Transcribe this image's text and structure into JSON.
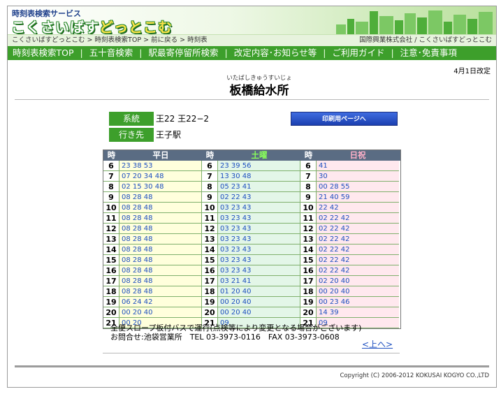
{
  "header": {
    "service_label": "時刻表検索サービス",
    "logo_part1": "こくさいばす",
    "logo_part2": "どっとこむ"
  },
  "breadcrumb": {
    "items": [
      "こくさいばすどっとこむ",
      "時刻表検索TOP",
      "前に戻る",
      "時刻表"
    ],
    "sep": ">",
    "company": "国際興業株式会社",
    "company_sep": "/",
    "site": "こくさいばすどっとこむ"
  },
  "menu": {
    "items": [
      "時刻表検索TOP",
      "五十音検索",
      "駅最寄停留所検索",
      "改定内容･お知らせ等",
      "ご利用ガイド",
      "注意･免責事項"
    ],
    "sep": "|"
  },
  "page": {
    "revised": "4月1日改定",
    "stop_ruby": "いたばしきゅうすいじょ",
    "stop_name": "板橋給水所"
  },
  "route": {
    "route_label": "系統",
    "route_value": "王22 王22−2",
    "dest_label": "行き先",
    "dest_value": "王子駅",
    "print_button": "印刷用ページへ"
  },
  "timetable": {
    "headers": [
      {
        "hour": "時",
        "day": "平日"
      },
      {
        "hour": "時",
        "day": "土曜"
      },
      {
        "hour": "時",
        "day": "日祝"
      }
    ],
    "header_colors": [
      "#ffffff",
      "#8aff5a",
      "#ffb0c8"
    ],
    "rows": [
      {
        "hour": "6",
        "weekday": "23 38 53",
        "saturday": "23 39 56",
        "holiday": "41"
      },
      {
        "hour": "7",
        "weekday": "07 20 34 48",
        "saturday": "13 30 48",
        "holiday": "30"
      },
      {
        "hour": "8",
        "weekday": "02 15 30 48",
        "saturday": "05 23 41",
        "holiday": "00 28 55"
      },
      {
        "hour": "9",
        "weekday": "08 28 48",
        "saturday": "02 22 43",
        "holiday": "21 40 59"
      },
      {
        "hour": "10",
        "weekday": "08 28 48",
        "saturday": "03 23 43",
        "holiday": "22 42"
      },
      {
        "hour": "11",
        "weekday": "08 28 48",
        "saturday": "03 23 43",
        "holiday": "02 22 42"
      },
      {
        "hour": "12",
        "weekday": "08 28 48",
        "saturday": "03 23 43",
        "holiday": "02 22 42"
      },
      {
        "hour": "13",
        "weekday": "08 28 48",
        "saturday": "03 23 43",
        "holiday": "02 22 42"
      },
      {
        "hour": "14",
        "weekday": "08 28 48",
        "saturday": "03 23 43",
        "holiday": "02 22 42"
      },
      {
        "hour": "15",
        "weekday": "08 28 48",
        "saturday": "03 23 43",
        "holiday": "02 22 42"
      },
      {
        "hour": "16",
        "weekday": "08 28 48",
        "saturday": "03 23 43",
        "holiday": "02 22 42"
      },
      {
        "hour": "17",
        "weekday": "08 28 48",
        "saturday": "03 21 41",
        "holiday": "02 20 40"
      },
      {
        "hour": "18",
        "weekday": "08 28 48",
        "saturday": "01 20 40",
        "holiday": "00 20 40"
      },
      {
        "hour": "19",
        "weekday": "06 24 42",
        "saturday": "00 20 40",
        "holiday": "00 23 46"
      },
      {
        "hour": "20",
        "weekday": "00 20 40",
        "saturday": "00 20 40",
        "holiday": "14 39"
      },
      {
        "hour": "21",
        "weekday": "00 20",
        "saturday": "09",
        "holiday": "09"
      }
    ]
  },
  "notes": {
    "line1": "全便スロープ板付バスで運行(点検等により変更となる場合がございます)",
    "line2": "お問合せ:池袋営業所　TEL 03-3973-0116　FAX 03-3973-0608",
    "up_link": "<上へ>"
  },
  "footer": {
    "copyright": "Copyright (C) 2006-2012 KOKUSAI KOGYO CO.,LTD"
  }
}
